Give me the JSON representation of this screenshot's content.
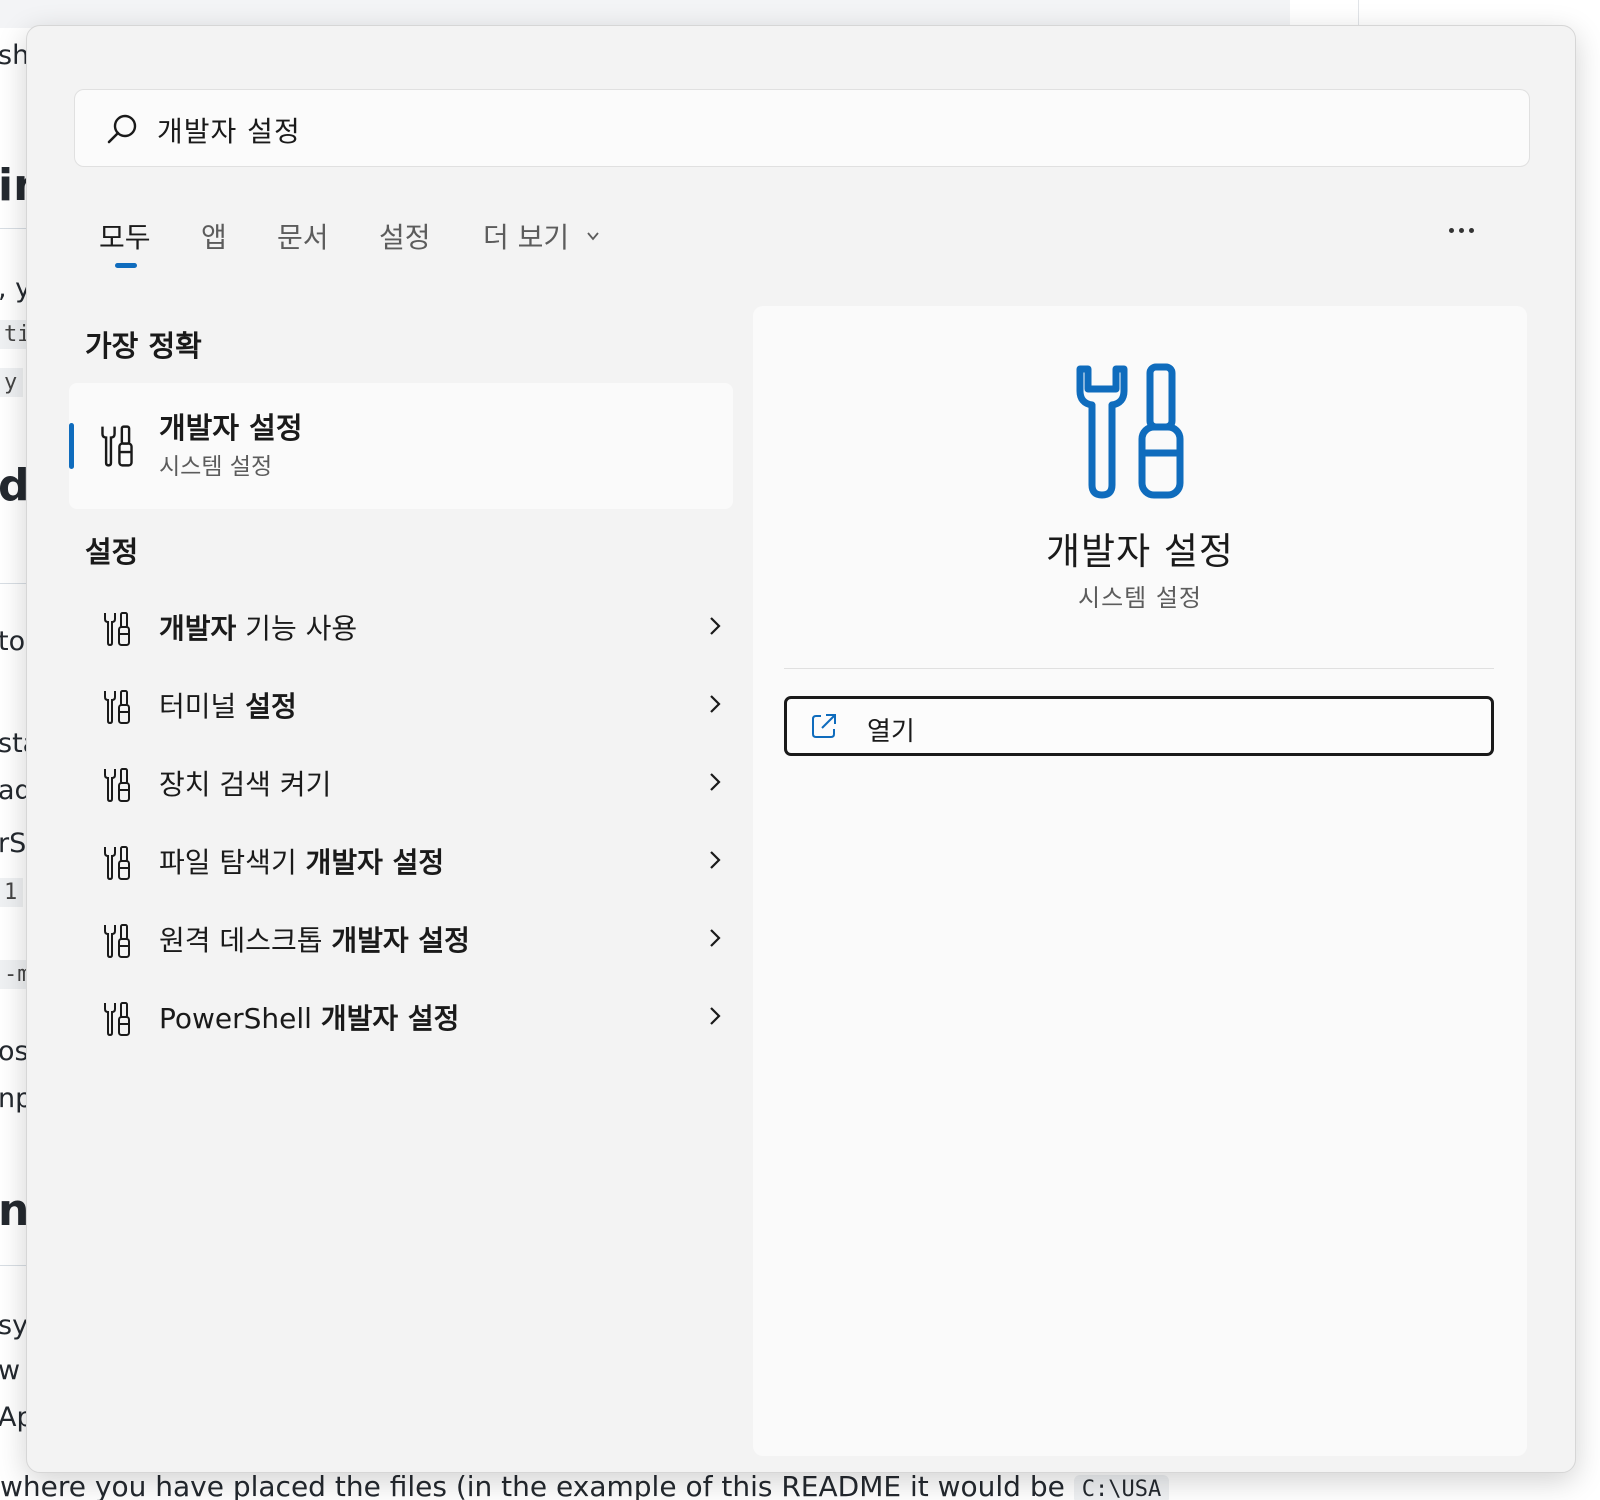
{
  "background_doc": {
    "fragments": [
      "sh",
      "in",
      ", y",
      "tic",
      "y",
      "d",
      "to",
      "sta",
      "ad",
      "rS",
      "1",
      "-m",
      "os,",
      "np",
      "n",
      "sy",
      "w",
      "Ap"
    ],
    "bottom_text": "where you have placed the files (in the example of this README it would be",
    "bottom_code": "C:\\USA"
  },
  "search": {
    "query": "개발자 설정"
  },
  "tabs": [
    {
      "label": "모두"
    },
    {
      "label": "앱"
    },
    {
      "label": "문서"
    },
    {
      "label": "설정"
    },
    {
      "label": "더 보기"
    }
  ],
  "best_match": {
    "section_title": "가장 정확",
    "title": "개발자 설정",
    "subtitle": "시스템 설정"
  },
  "settings": {
    "section_title": "설정",
    "items": [
      {
        "bold_before": "개발자",
        "plain": " 기능 사용",
        "bold_after": ""
      },
      {
        "bold_before": "",
        "plain": "터미널 ",
        "bold_after": "설정"
      },
      {
        "bold_before": "",
        "plain": "장치 검색 켜기",
        "bold_after": ""
      },
      {
        "bold_before": "",
        "plain": "파일 탐색기 ",
        "bold_after": "개발자 설정"
      },
      {
        "bold_before": "",
        "plain": "원격 데스크톱 ",
        "bold_after": "개발자 설정"
      },
      {
        "bold_before": "",
        "plain": "PowerShell ",
        "bold_after": "개발자 설정"
      }
    ]
  },
  "detail": {
    "title": "개발자 설정",
    "subtitle": "시스템 설정",
    "open_label": "열기"
  },
  "colors": {
    "accent": "#0f6cbd",
    "panel_bg": "#f3f3f3"
  },
  "icons": {
    "search": "search-icon",
    "tools": "developer-tools-icon",
    "chevron": "chevron-right-icon",
    "open": "open-external-icon",
    "more": "more-icon"
  }
}
